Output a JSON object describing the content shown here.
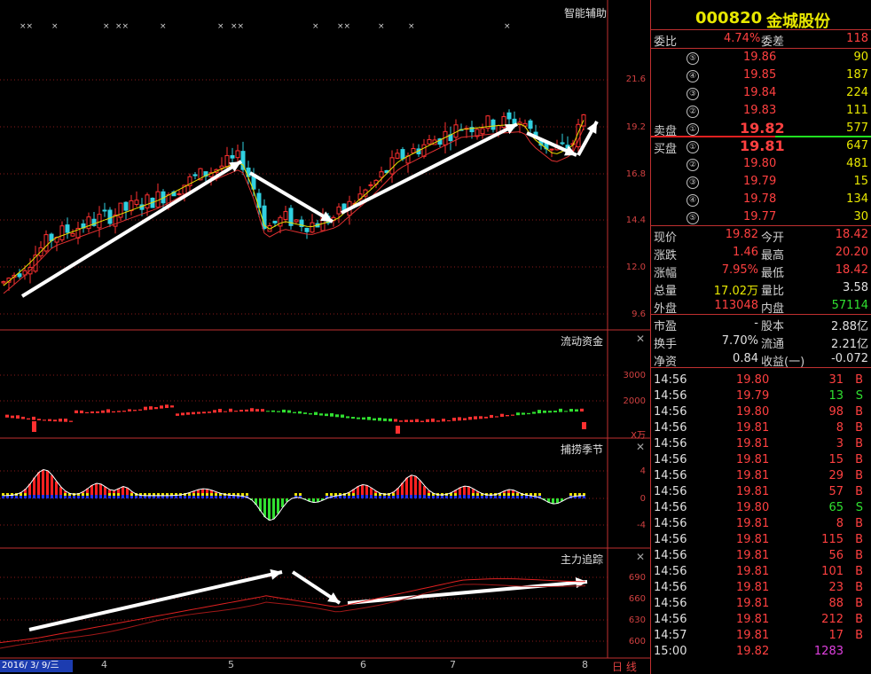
{
  "stock": {
    "code": "000820",
    "name": "金城股份"
  },
  "panels": {
    "main": {
      "title": "智能辅助",
      "ticks": [
        "21.6",
        "19.2",
        "16.8",
        "14.4",
        "12.0",
        "9.6"
      ]
    },
    "flow": {
      "title": "流动资金",
      "ticks": [
        "3000",
        "2000"
      ],
      "unit": "X万"
    },
    "season": {
      "title": "捕捞季节",
      "ticks": [
        "4",
        "0",
        "-4"
      ]
    },
    "track": {
      "title": "主力追踪",
      "ticks": [
        "690",
        "660",
        "630",
        "600"
      ]
    }
  },
  "xaxis": {
    "date_label": "2016/ 3/ 9/三",
    "months": [
      "4",
      "5",
      "6",
      "7",
      "8"
    ],
    "period": "日 线"
  },
  "close_glyph": "✕",
  "chart_data": [
    {
      "type": "candlestick",
      "title": "智能辅助",
      "ylim": [
        9.6,
        21.6
      ],
      "last_price": 19.82,
      "note_series": [
        "MA"
      ]
    },
    {
      "type": "bar",
      "title": "流动资金",
      "ylim": [
        0,
        3000
      ]
    },
    {
      "type": "bar",
      "title": "捕捞季节",
      "ylim": [
        -4,
        4
      ]
    },
    {
      "type": "line",
      "title": "主力追踪",
      "ylim": [
        590,
        700
      ]
    }
  ],
  "quote": {
    "weibi": {
      "label1": "委比",
      "value1": "4.74%",
      "label2": "委差",
      "value2": "118"
    },
    "sell": [
      {
        "level": "⑤",
        "price": "19.86",
        "vol": "90"
      },
      {
        "level": "④",
        "price": "19.85",
        "vol": "187"
      },
      {
        "level": "③",
        "price": "19.84",
        "vol": "224"
      },
      {
        "level": "②",
        "price": "19.83",
        "vol": "111"
      },
      {
        "level": "①",
        "price": "19.82",
        "vol": "577",
        "label": "卖盘"
      }
    ],
    "buy": [
      {
        "level": "①",
        "price": "19.81",
        "vol": "647",
        "label": "买盘"
      },
      {
        "level": "②",
        "price": "19.80",
        "vol": "481"
      },
      {
        "level": "③",
        "price": "19.79",
        "vol": "15"
      },
      {
        "level": "④",
        "price": "19.78",
        "vol": "134"
      },
      {
        "level": "⑤",
        "price": "19.77",
        "vol": "30"
      }
    ],
    "stats": [
      {
        "l1": "现价",
        "v1": "19.82",
        "c1": "red",
        "l2": "今开",
        "v2": "18.42",
        "c2": "red"
      },
      {
        "l1": "涨跌",
        "v1": "1.46",
        "c1": "red",
        "l2": "最高",
        "v2": "20.20",
        "c2": "red"
      },
      {
        "l1": "涨幅",
        "v1": "7.95%",
        "c1": "red",
        "l2": "最低",
        "v2": "18.42",
        "c2": "red"
      },
      {
        "l1": "总量",
        "v1": "17.02万",
        "c1": "yellow",
        "l2": "量比",
        "v2": "3.58",
        "c2": "white"
      },
      {
        "l1": "外盘",
        "v1": "113048",
        "c1": "red",
        "l2": "内盘",
        "v2": "57114",
        "c2": "green"
      }
    ],
    "fund": [
      {
        "l1": "市盈",
        "v1": "-",
        "l2": "股本",
        "v2": "2.88亿"
      },
      {
        "l1": "换手",
        "v1": "7.70%",
        "l2": "流通",
        "v2": "2.21亿"
      },
      {
        "l1": "净资",
        "v1": "0.84",
        "l2": "收益(一)",
        "v2": "-0.072"
      }
    ],
    "ticks": [
      {
        "t": "14:56",
        "p": "19.80",
        "v": "31",
        "s": "B"
      },
      {
        "t": "14:56",
        "p": "19.79",
        "v": "13",
        "s": "S"
      },
      {
        "t": "14:56",
        "p": "19.80",
        "v": "98",
        "s": "B"
      },
      {
        "t": "14:56",
        "p": "19.81",
        "v": "8",
        "s": "B"
      },
      {
        "t": "14:56",
        "p": "19.81",
        "v": "3",
        "s": "B"
      },
      {
        "t": "14:56",
        "p": "19.81",
        "v": "15",
        "s": "B"
      },
      {
        "t": "14:56",
        "p": "19.81",
        "v": "29",
        "s": "B"
      },
      {
        "t": "14:56",
        "p": "19.81",
        "v": "57",
        "s": "B"
      },
      {
        "t": "14:56",
        "p": "19.80",
        "v": "65",
        "s": "S"
      },
      {
        "t": "14:56",
        "p": "19.81",
        "v": "8",
        "s": "B"
      },
      {
        "t": "14:56",
        "p": "19.81",
        "v": "115",
        "s": "B"
      },
      {
        "t": "14:56",
        "p": "19.81",
        "v": "56",
        "s": "B"
      },
      {
        "t": "14:56",
        "p": "19.81",
        "v": "101",
        "s": "B"
      },
      {
        "t": "14:56",
        "p": "19.81",
        "v": "23",
        "s": "B"
      },
      {
        "t": "14:56",
        "p": "19.81",
        "v": "88",
        "s": "B"
      },
      {
        "t": "14:56",
        "p": "19.81",
        "v": "212",
        "s": "B"
      },
      {
        "t": "14:57",
        "p": "19.81",
        "v": "17",
        "s": "B"
      },
      {
        "t": "15:00",
        "p": "19.82",
        "v": "1283",
        "s": ""
      }
    ]
  }
}
